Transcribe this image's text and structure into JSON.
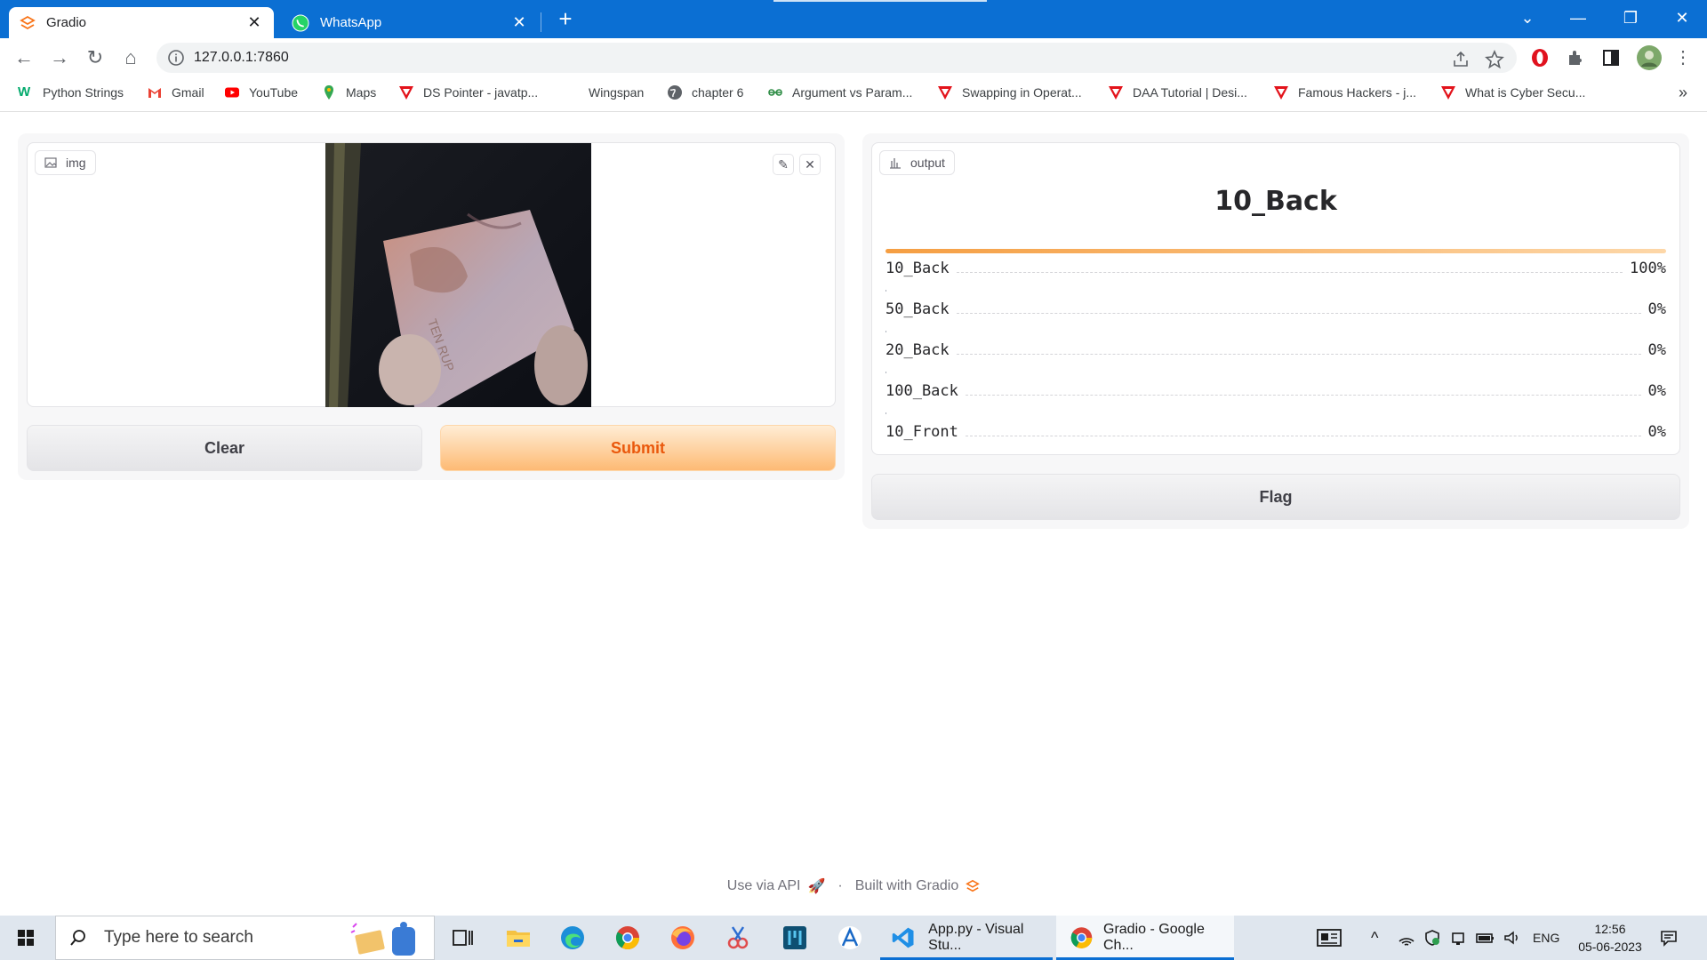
{
  "browser": {
    "tabs": [
      {
        "title": "Gradio",
        "icon": "gradio-logo-icon",
        "active": true
      },
      {
        "title": "WhatsApp",
        "icon": "whatsapp-icon",
        "active": false
      }
    ],
    "url": "127.0.0.1:7860",
    "accent_color": "#0b6fd3"
  },
  "bookmarks": [
    {
      "label": "Python Strings",
      "icon": "w3schools-icon"
    },
    {
      "label": "Gmail",
      "icon": "gmail-icon"
    },
    {
      "label": "YouTube",
      "icon": "youtube-icon"
    },
    {
      "label": "Maps",
      "icon": "maps-pin-icon"
    },
    {
      "label": "DS Pointer - javatp...",
      "icon": "javatpoint-icon"
    },
    {
      "label": "Wingspan",
      "icon": "blank-page-icon"
    },
    {
      "label": "chapter 6",
      "icon": "globe-icon"
    },
    {
      "label": "Argument vs Param...",
      "icon": "geeksforgeeks-icon"
    },
    {
      "label": "Swapping in Operat...",
      "icon": "javatpoint-icon"
    },
    {
      "label": "DAA Tutorial | Desi...",
      "icon": "javatpoint-icon"
    },
    {
      "label": "Famous Hackers - j...",
      "icon": "javatpoint-icon"
    },
    {
      "label": "What is Cyber Secu...",
      "icon": "javatpoint-icon"
    }
  ],
  "input_panel": {
    "label": "img",
    "clear_label": "Clear",
    "submit_label": "Submit"
  },
  "output_panel": {
    "label": "output",
    "top_label": "10_Back",
    "confidences": [
      {
        "label": "10_Back",
        "percent_text": "100%",
        "fraction": 1.0
      },
      {
        "label": "50_Back",
        "percent_text": "0%",
        "fraction": 0.0
      },
      {
        "label": "20_Back",
        "percent_text": "0%",
        "fraction": 0.0
      },
      {
        "label": "100_Back",
        "percent_text": "0%",
        "fraction": 0.0
      },
      {
        "label": "10_Front",
        "percent_text": "0%",
        "fraction": 0.0
      }
    ],
    "flag_label": "Flag"
  },
  "footer": {
    "api_text": "Use via API",
    "separator": "·",
    "built_text": "Built with Gradio"
  },
  "taskbar": {
    "search_placeholder": "Type here to search",
    "tasks": [
      {
        "label": "App.py - Visual Stu...",
        "icon": "vscode-icon"
      },
      {
        "label": "Gradio - Google Ch...",
        "icon": "chrome-icon"
      }
    ],
    "language": "ENG",
    "time": "12:56",
    "date": "05-06-2023"
  }
}
